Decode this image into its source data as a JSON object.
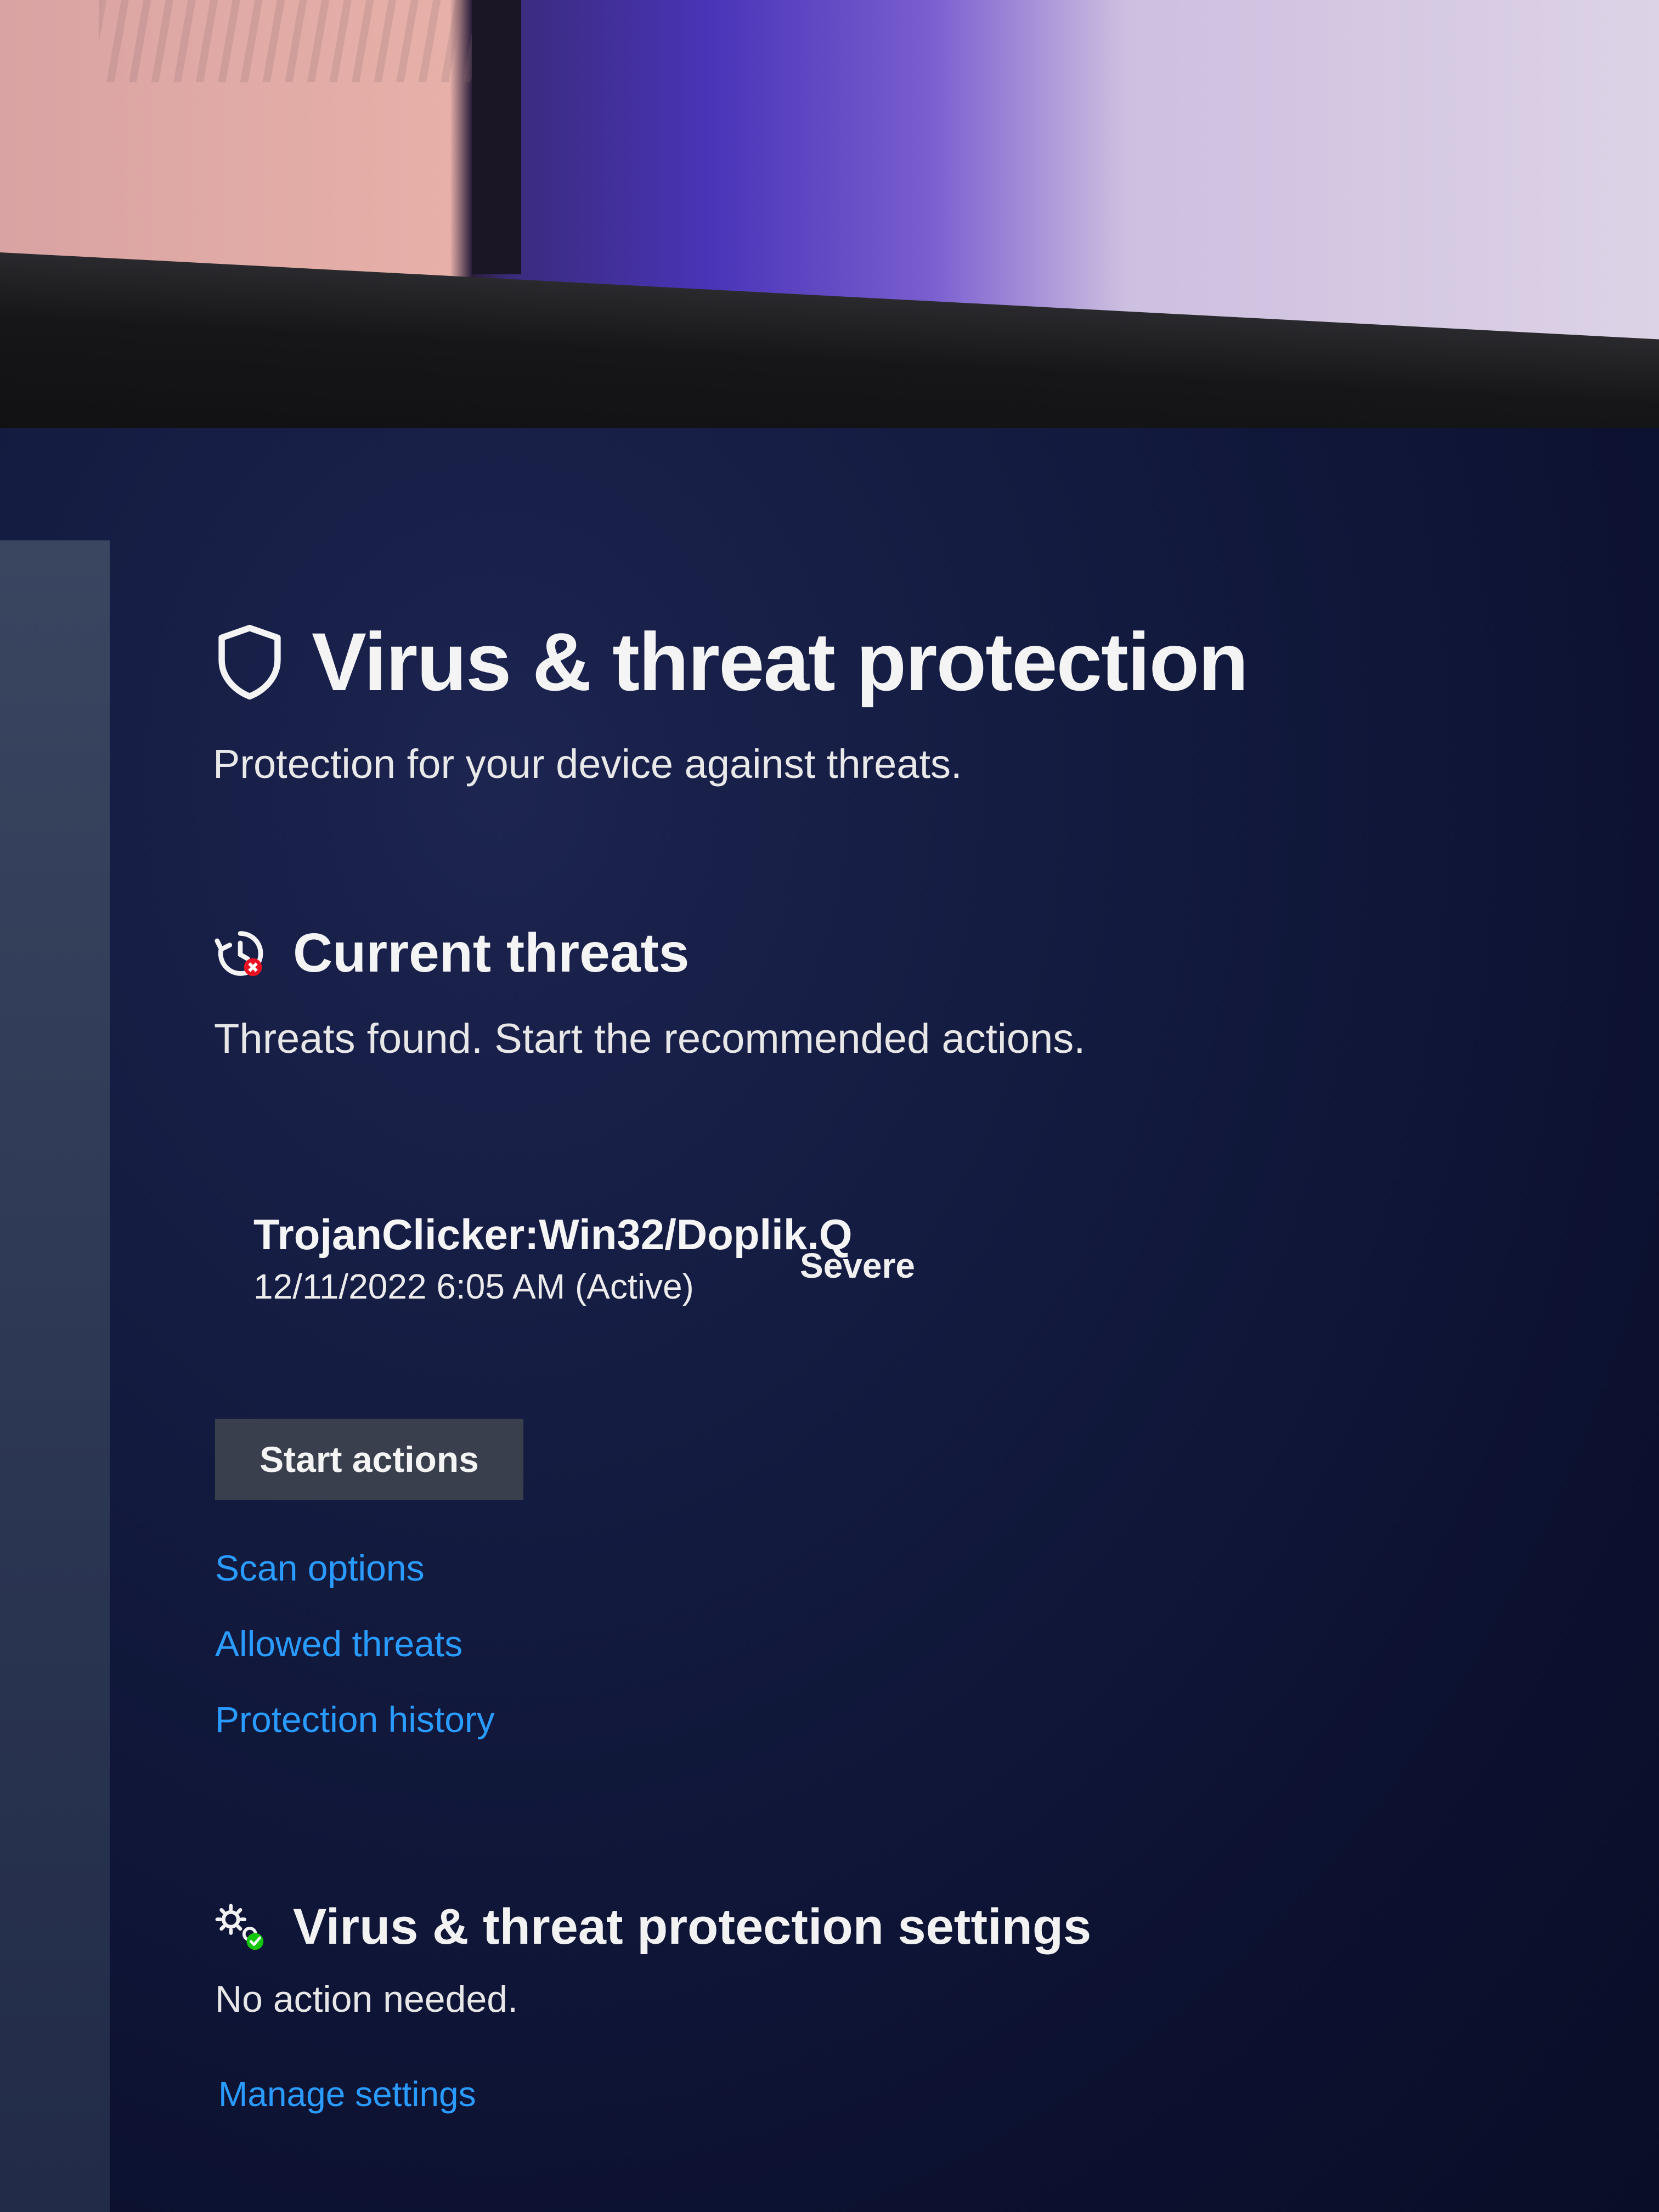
{
  "page": {
    "title": "Virus & threat protection",
    "subtitle": "Protection for your device against threats.",
    "icon": "shield-icon"
  },
  "current_threats": {
    "title": "Current threats",
    "icon": "threat-history-icon",
    "description": "Threats found. Start the recommended actions.",
    "threats": [
      {
        "name": "TrojanClicker:Win32/Doplik.Q",
        "date": "12/11/2022 6:05 AM (Active)",
        "severity": "Severe"
      }
    ],
    "start_button_label": "Start actions",
    "links": [
      {
        "label": "Scan options"
      },
      {
        "label": "Allowed threats"
      },
      {
        "label": "Protection history"
      }
    ]
  },
  "settings": {
    "title": "Virus & threat protection settings",
    "icon": "settings-gear-icon",
    "description": "No action needed.",
    "manage_link": "Manage settings"
  },
  "colors": {
    "link": "#2a9bff",
    "button_bg": "#3a3f4e",
    "screen_bg": "#121a3e",
    "alert_red": "#e81123",
    "ok_green": "#16c60c"
  }
}
